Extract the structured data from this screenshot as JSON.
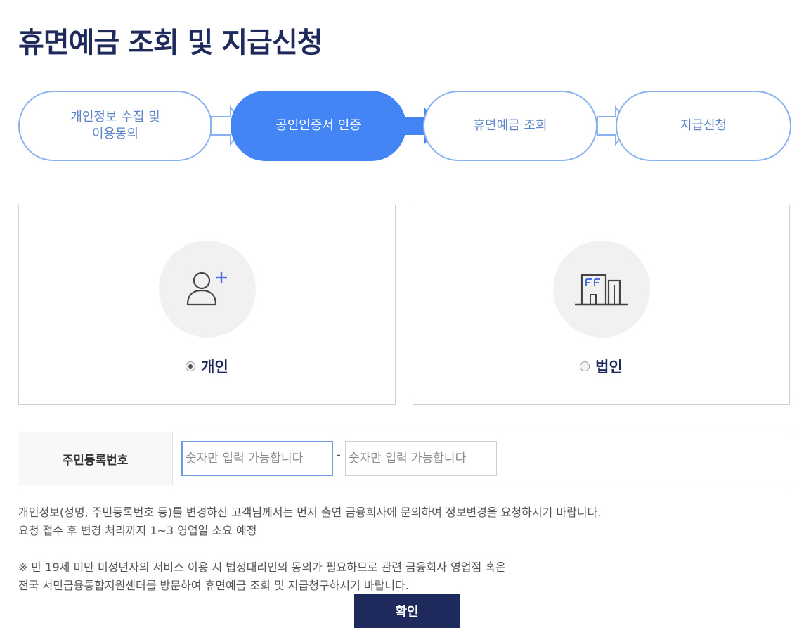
{
  "page": {
    "title": "휴면예금 조회 및 지급신청"
  },
  "steps": [
    {
      "line1": "개인정보 수집 및",
      "line2": "이용동의",
      "active": false
    },
    {
      "line1": "공인인증서 인증",
      "line2": "",
      "active": true
    },
    {
      "line1": "휴면예금 조회",
      "line2": "",
      "active": false
    },
    {
      "line1": "지급신청",
      "line2": "",
      "active": false
    }
  ],
  "customer_type": {
    "personal": {
      "label": "개인",
      "icon": "person-add-icon",
      "selected": true
    },
    "corporate": {
      "label": "법인",
      "icon": "building-icon",
      "selected": false
    }
  },
  "rrn": {
    "label": "주민등록번호",
    "front_placeholder": "숫자만 입력 가능합니다",
    "separator": "-",
    "back_placeholder": "숫자만 입력 가능합니다"
  },
  "notice": {
    "line1": "개인정보(성명, 주민등록번호 등)를 변경하신 고객님께서는 먼저 출연 금융회사에 문의하여 정보변경을 요청하시기 바랍니다.",
    "line2": "요청 접수 후 변경 처리까지 1~3 영업일 소요 예정",
    "line3": "※ 만 19세 미만 미성년자의 서비스 이용 시 법정대리인의 동의가 필요하므로 관련 금융회사 영업점 혹은",
    "line4": "전국 서민금융통합지원센터를 방문하여 휴면예금 조회 및 지급청구하시기 바랍니다."
  },
  "confirm_label": "확인",
  "colors": {
    "navy": "#1d2a5b",
    "active_step": "#4385f5",
    "step_border": "#8bb2f0",
    "icon_accent": "#4a6fe0"
  }
}
